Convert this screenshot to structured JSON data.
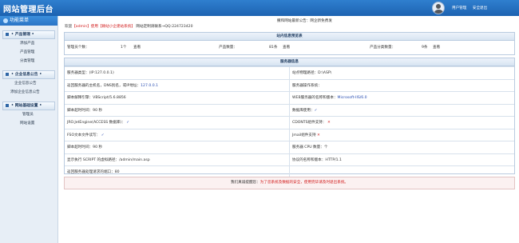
{
  "header": {
    "brand": "网站管理后台",
    "user_manage": "用户管理",
    "logout": "安全退出"
  },
  "sidebar": {
    "title": "功能菜单",
    "groups": [
      {
        "title": "• 产品管理 •",
        "items": [
          "添加产品",
          "产品管理",
          "分类管理"
        ]
      },
      {
        "title": "• 企业信息公告 •",
        "items": [
          "企业信息公告",
          "添加企业信息公告"
        ]
      },
      {
        "title": "• 网站基础设置 •",
        "items": [
          "管理员",
          "网站设置"
        ]
      }
    ]
  },
  "main": {
    "notice": "撒和网站最新公告：网企新免费发",
    "welcome_prefix": "欢迎",
    "welcome_user": "【admin】",
    "welcome_mid": "使用【赖站小企建站系统】",
    "welcome_suffix": "网站定制请联系→QQ:224723420"
  },
  "overview": {
    "title": "站内信息预览表",
    "admin_label": "管理员个数：",
    "admin_count": "1个",
    "admin_view": "查看",
    "product_label": "产品数量：",
    "product_count": "81条",
    "product_view": "查看",
    "category_label": "产品分类数量：",
    "category_count": "9条",
    "category_view": "查看"
  },
  "server": {
    "title": "服务器信息",
    "rows": [
      [
        {
          "label": "服务器类型：",
          "value": "(IP:127.0.0.1)"
        },
        {
          "label": "站点物理路径：",
          "value": "D:\\ASP\\"
        }
      ],
      [
        {
          "label": "返回服务器的主机名，DNS别名，或IP地址：",
          "value": "127.0.0.1"
        },
        {
          "label": "服务器操作系统：",
          "value": ""
        }
      ],
      [
        {
          "label": "脚本解释引擎：",
          "value": "VBScript/5.6.8856"
        },
        {
          "label": "WEB服务器的名称和版本：",
          "value": "Microsoft-IIS/6.0"
        }
      ],
      [
        {
          "label": "脚本超时时间：",
          "value": "90 秒"
        },
        {
          "label": "数据库使用：",
          "value": "✓"
        }
      ],
      [
        {
          "label": "JRO.JetEngine(ACCESS 数据库)：",
          "value": "✓"
        },
        {
          "label": "CDONTS组件支持：",
          "value": "✕"
        }
      ],
      [
        {
          "label": "FSO文本文件读写：",
          "value": "✓"
        },
        {
          "label": "Jmail组件支持",
          "value": "✕"
        }
      ],
      [
        {
          "label": "脚本超时时间：",
          "value": "90 秒"
        },
        {
          "label": "服务器 CPU 数量：",
          "value": "个"
        }
      ],
      [
        {
          "label": "显示执行 SCRIPT 的虚拟路径：",
          "value": "/admin/main.asp"
        },
        {
          "label": "协议的名称和版本：",
          "value": "HTTP/1.1"
        }
      ],
      [
        {
          "label": "返回服务器处理请求的端口：",
          "value": "80"
        },
        {
          "label": "",
          "value": ""
        }
      ]
    ]
  },
  "footer": {
    "prefix": "我们真诚提醒您：",
    "text": "为了您系统及数据的安全，使用完毕请及时退出系统。"
  }
}
